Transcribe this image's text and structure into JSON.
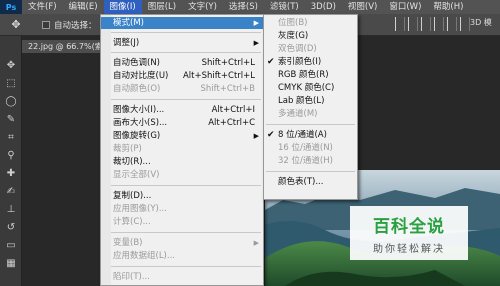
{
  "app": {
    "logo": "Ps"
  },
  "menubar": [
    "文件(F)",
    "编辑(E)",
    "图像(I)",
    "图层(L)",
    "文字(Y)",
    "选择(S)",
    "滤镜(T)",
    "3D(D)",
    "视图(V)",
    "窗口(W)",
    "帮助(H)"
  ],
  "options": {
    "auto_select_label": "自动选择：",
    "three_d": "3D 模"
  },
  "document": {
    "tab": "22.jpg @ 66.7%(索"
  },
  "image_menu": {
    "mode": "模式(M)",
    "adjust": "调整(J)",
    "auto_tone": {
      "label": "自动色调(N)",
      "shortcut": "Shift+Ctrl+L"
    },
    "auto_contrast": {
      "label": "自动对比度(U)",
      "shortcut": "Alt+Shift+Ctrl+L"
    },
    "auto_color": {
      "label": "自动颜色(O)",
      "shortcut": "Shift+Ctrl+B"
    },
    "image_size": {
      "label": "图像大小(I)...",
      "shortcut": "Alt+Ctrl+I"
    },
    "canvas_size": {
      "label": "画布大小(S)...",
      "shortcut": "Alt+Ctrl+C"
    },
    "rotation": "图像旋转(G)",
    "crop": "裁剪(P)",
    "trim": "裁切(R)...",
    "reveal_all": "显示全部(V)",
    "duplicate": "复制(D)...",
    "apply_image": "应用图像(Y)...",
    "calculations": "计算(C)...",
    "variables": "变量(B)",
    "apply_data_set": "应用数据组(L)...",
    "trap": "陷印(T)..."
  },
  "mode_menu": {
    "bitmap": "位图(B)",
    "grayscale": "灰度(G)",
    "duotone": "双色调(D)",
    "indexed": "索引颜色(I)",
    "rgb": "RGB 颜色(R)",
    "cmyk": "CMYK 颜色(C)",
    "lab": "Lab 颜色(L)",
    "multichannel": "多通道(M)",
    "bits8": "8 位/通道(A)",
    "bits16": "16 位/通道(N)",
    "bits32": "32 位/通道(H)",
    "color_table": "颜色表(T)..."
  },
  "watermark": {
    "title": "百科全说",
    "subtitle": "助你轻松解决"
  },
  "colors": {
    "menu_highlight": "#3b83c9",
    "menubar_active": "#2f5fbf",
    "watermark_green": "#2aa040"
  }
}
